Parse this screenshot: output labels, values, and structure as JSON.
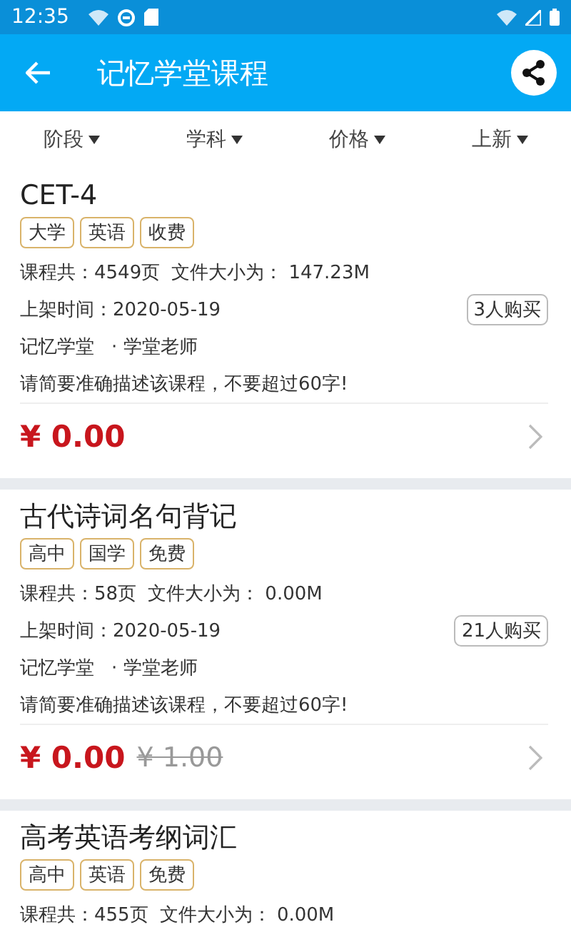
{
  "status_bar": {
    "time": "12:35"
  },
  "app_bar": {
    "title": "记忆学堂课程"
  },
  "filters": [
    {
      "label": "阶段"
    },
    {
      "label": "学科"
    },
    {
      "label": "价格"
    },
    {
      "label": "上新"
    }
  ],
  "courses": [
    {
      "title": "CET-4",
      "tags": [
        "大学",
        "英语",
        "收费"
      ],
      "pages": "课程共：4549页",
      "size": "文件大小为：  147.23M",
      "date": "上架时间：2020-05-19",
      "buyers": "3人购买",
      "author": "记忆学堂",
      "teacher": "· 学堂老师",
      "description": "请简要准确描述该课程，不要超过60字!",
      "price": "¥ 0.00"
    },
    {
      "title": "古代诗词名句背记",
      "tags": [
        "高中",
        "国学",
        "免费"
      ],
      "pages": "课程共：58页",
      "size": "文件大小为：  0.00M",
      "date": "上架时间：2020-05-19",
      "buyers": "21人购买",
      "author": "记忆学堂",
      "teacher": "· 学堂老师",
      "description": "请简要准确描述该课程，不要超过60字!",
      "price": "¥ 0.00",
      "original_price": "¥ 1.00"
    },
    {
      "title": "高考英语考纲词汇",
      "tags": [
        "高中",
        "英语",
        "免费"
      ],
      "pages": "课程共：455页",
      "size": "文件大小为：  0.00M"
    }
  ]
}
